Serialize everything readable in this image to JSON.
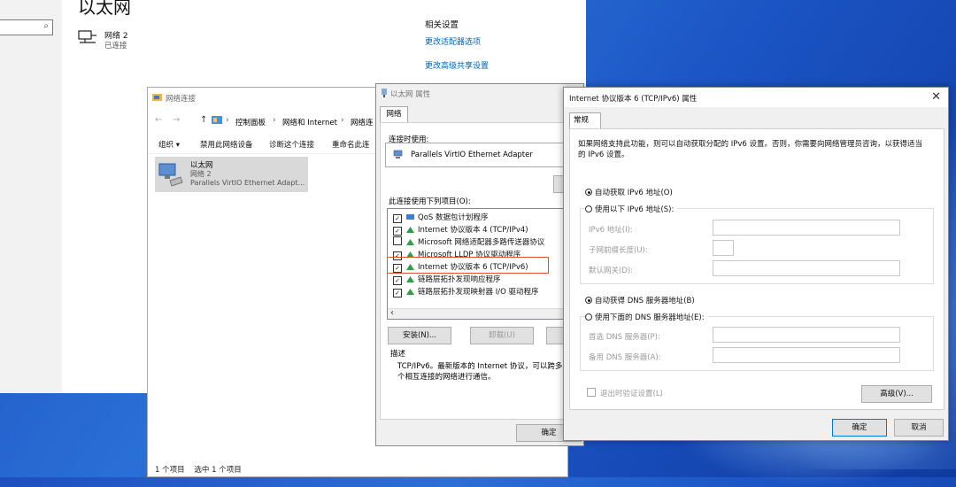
{
  "settings": {
    "title": "以太网",
    "search_icon": "⌕",
    "network": {
      "name": "网络 2",
      "status": "已连接"
    },
    "related": {
      "title": "相关设置",
      "links": [
        "更改适配器选项",
        "更改高级共享设置"
      ]
    }
  },
  "netconn": {
    "title": "网络连接",
    "nav": {
      "back": "←",
      "forward": "→",
      "up": "↑",
      "sep": "›"
    },
    "breadcrumb": [
      "控制面板",
      "网络和 Internet",
      "网络连"
    ],
    "toolbar": [
      "组织 ▾",
      "禁用此网络设备",
      "诊断这个连接",
      "重命名此连"
    ],
    "item": {
      "name": "以太网",
      "network": "网络 2",
      "adapter": "Parallels VirtIO Ethernet Adapt..."
    },
    "status": "1 个项目    选中 1 个项目",
    "view_icons": "⊞ ▭"
  },
  "ethprop": {
    "title": "以太网 属性",
    "tab": "网络",
    "connect_using_label": "连接时使用:",
    "adapter": "Parallels VirtIO Ethernet Adapter",
    "items_label": "此连接使用下列项目(O):",
    "items": [
      {
        "label": "QoS 数据包计划程序",
        "checked": "✓"
      },
      {
        "label": "Internet 协议版本 4 (TCP/IPv4)",
        "checked": "✓"
      },
      {
        "label": "Microsoft 网络适配器多路传送器协议",
        "checked": ""
      },
      {
        "label": "Microsoft LLDP 协议驱动程序",
        "checked": "✓"
      },
      {
        "label": "Internet 协议版本 6 (TCP/IPv6)",
        "checked": "✓"
      },
      {
        "label": "链路层拓扑发现响应程序",
        "checked": "✓"
      },
      {
        "label": "链路层拓扑发现映射器 I/O 驱动程序",
        "checked": "✓"
      }
    ],
    "scroll_left": "‹",
    "buttons": {
      "install": "安装(N)...",
      "uninstall": "卸载(U)",
      "ok": "确定"
    },
    "desc_title": "描述",
    "desc_text": "TCP/IPv6。最新版本的 Internet 协议，可以跨多个相互连接的网络进行通信。"
  },
  "ipv6": {
    "title": "Internet 协议版本 6 (TCP/IPv6) 属性",
    "close": "✕",
    "tab": "常规",
    "intro": "如果网络支持此功能，则可以自动获取分配的 IPv6 设置。否则，你需要向网络管理员咨询，以获得适当的 IPv6 设置。",
    "auto_ip": "自动获取 IPv6 地址(O)",
    "manual_ip": "使用以下 IPv6 地址(S):",
    "ip_label": "IPv6 地址(I):",
    "prefix_label": "子网前缀长度(U):",
    "gateway_label": "默认网关(D):",
    "auto_dns": "自动获得 DNS 服务器地址(B)",
    "manual_dns": "使用下面的 DNS 服务器地址(E):",
    "pref_dns": "首选 DNS 服务器(P):",
    "alt_dns": "备用 DNS 服务器(A):",
    "validate": "退出时验证设置(L)",
    "advanced": "高级(V)...",
    "ok": "确定",
    "cancel": "取消"
  }
}
